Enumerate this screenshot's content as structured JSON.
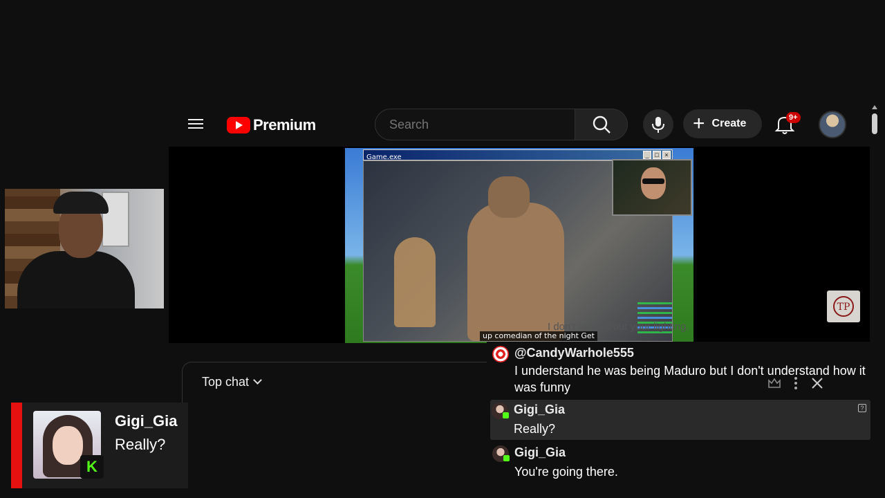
{
  "header": {
    "logo_text": "Premium",
    "search_placeholder": "Search",
    "create_label": "Create",
    "notification_count": "9+"
  },
  "video": {
    "game_window_title": "Game.exe",
    "caption": "up comedian of the night Get excited",
    "faded_subtitle": "I don't care about your lighting."
  },
  "chat": {
    "mode_label": "Top chat",
    "messages": [
      {
        "author": "@CandyWarhole555",
        "text": "I understand he was being Maduro but I don't understand how it was funny"
      },
      {
        "author": "Gigi_Gia",
        "text": "Really?"
      },
      {
        "author": "Gigi_Gia",
        "text": "You're going there."
      }
    ]
  },
  "alert": {
    "author": "Gigi_Gia",
    "text": "Really?",
    "platform_badge": "K"
  },
  "colors": {
    "accent_red": "#ff0000",
    "kick_green": "#53fc18",
    "alert_bar": "#e51010"
  }
}
